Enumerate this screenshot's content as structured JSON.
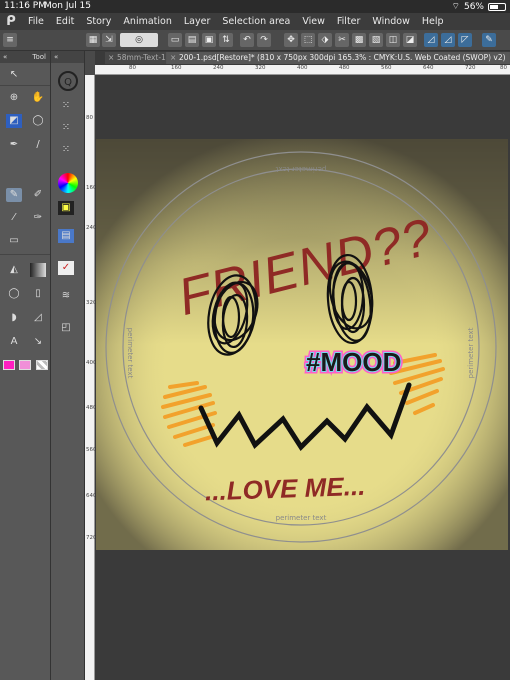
{
  "status_bar": {
    "time": "11:16 PM",
    "date": "Mon Jul 15",
    "battery": "56%"
  },
  "menu": {
    "items": [
      "File",
      "Edit",
      "Story",
      "Animation",
      "Layer",
      "Selection area",
      "View",
      "Filter",
      "Window",
      "Help"
    ]
  },
  "panel_label": "Tool",
  "tabs": [
    {
      "label": "58mm-Text-1",
      "active": false
    },
    {
      "label": "200-1.psd[Restore]* (810 x 750px 300dpi 165.3% : CMYK:U.S. Web Coated (SWOP) v2)",
      "active": true
    }
  ],
  "ruler_top": [
    "80",
    "160",
    "240",
    "320",
    "400",
    "480",
    "560",
    "640",
    "720",
    "80"
  ],
  "ruler_left": [
    "80",
    "160",
    "240",
    "320",
    "400",
    "480",
    "560",
    "640",
    "720"
  ],
  "artwork": {
    "headline": "FRIEND??",
    "hashtag": "#MOOD",
    "tagline": "...LOVE ME...",
    "perimeter_text": "perimeter text",
    "colors": {
      "background": "#e6dc8a",
      "red": "#8f2a25",
      "orange": "#f2a22c",
      "hashtag_fill": "#1a1a1a",
      "hashtag_glow": "#ff5fc8",
      "hashtag_outline": "#7cd6ee"
    }
  },
  "colors": {
    "main_color": "#ff1fc0",
    "sub_color": "#f08fd8"
  }
}
